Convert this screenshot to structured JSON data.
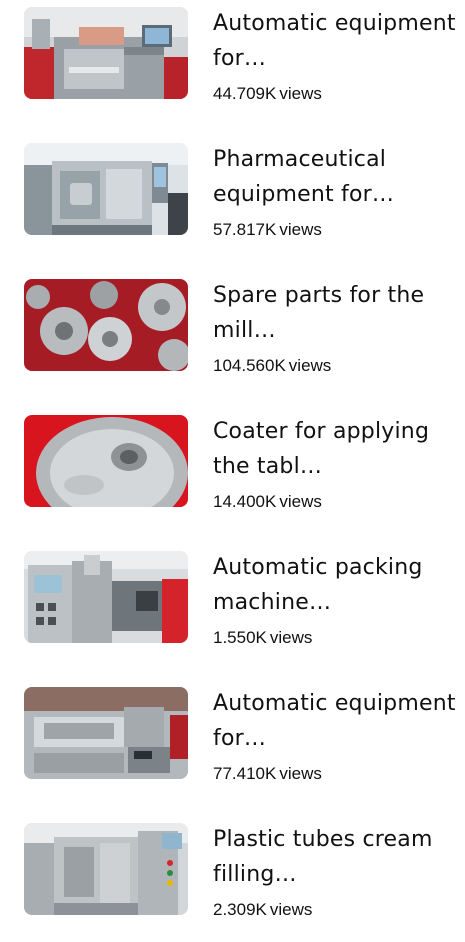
{
  "videos": [
    {
      "title": "Automatic equipment for…",
      "views": "44.709K",
      "views_unit": "views",
      "thumb": "packing-line"
    },
    {
      "title": "Pharmaceutical equipment for…",
      "views": "57.817K",
      "views_unit": "views",
      "thumb": "exhibition-machine"
    },
    {
      "title": "Spare parts for the mill…",
      "views": "104.560K",
      "views_unit": "views",
      "thumb": "gears"
    },
    {
      "title": "Coater for applying the tabl…",
      "views": "14.400K",
      "views_unit": "views",
      "thumb": "coater-drum"
    },
    {
      "title": "Automatic packing machine…",
      "views": "1.550K",
      "views_unit": "views",
      "thumb": "packing-machine"
    },
    {
      "title": "Automatic equipment for…",
      "views": "77.410K",
      "views_unit": "views",
      "thumb": "blister-machine"
    },
    {
      "title": "Plastic tubes cream filling…",
      "views": "2.309K",
      "views_unit": "views",
      "thumb": "tube-filler"
    }
  ]
}
